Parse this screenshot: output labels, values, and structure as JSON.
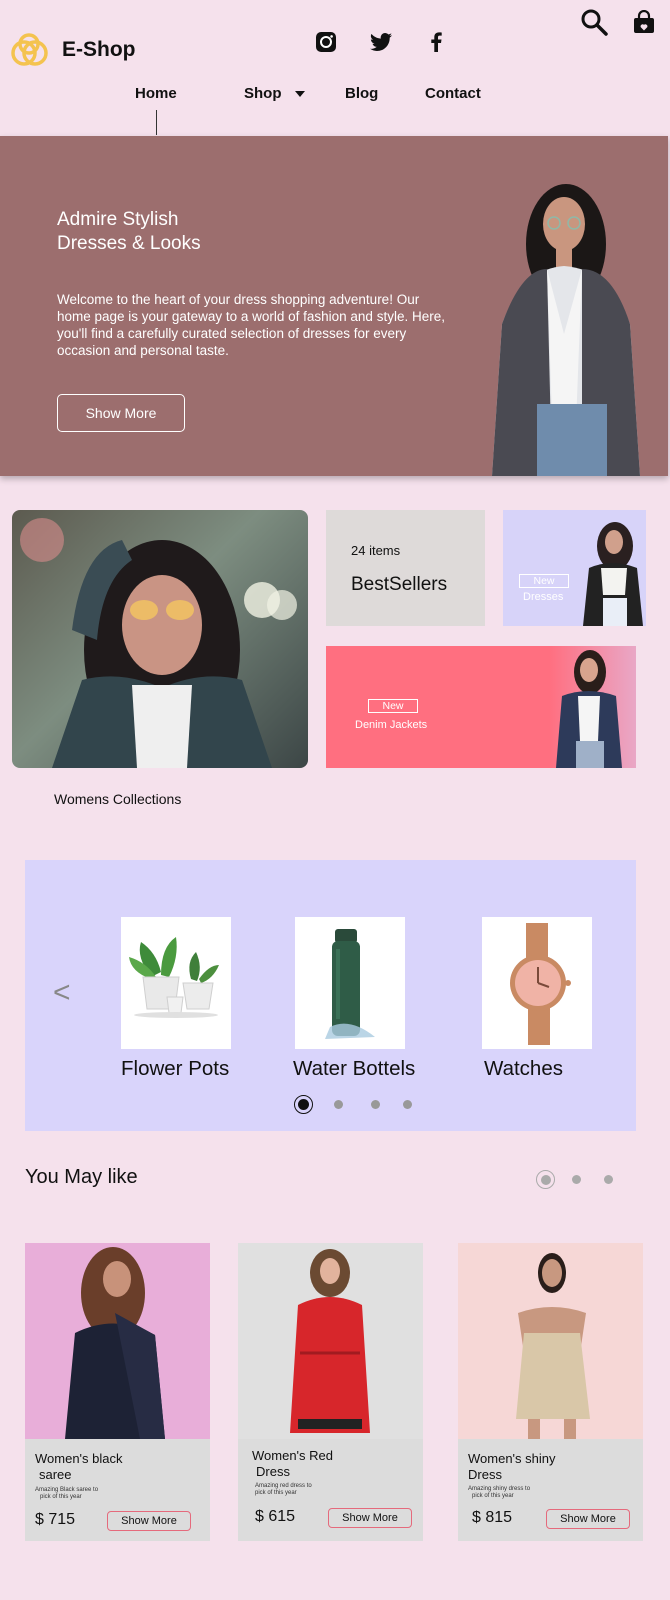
{
  "header": {
    "brand": "E-Shop",
    "logo_icon": "interlocking-rings-logo",
    "social": [
      "instagram-icon",
      "twitter-icon",
      "facebook-icon"
    ],
    "utility": [
      "search-icon",
      "shopping-bag-icon"
    ]
  },
  "nav": {
    "items": [
      {
        "label": "Home",
        "active": true
      },
      {
        "label": "Shop",
        "has_dropdown": true
      },
      {
        "label": "Blog"
      },
      {
        "label": "Contact"
      }
    ]
  },
  "hero": {
    "title_line1": "Admire Stylish",
    "title_line2": "Dresses & Looks",
    "text": "Welcome to the heart of your dress shopping adventure! Our home page is your gateway to a world of fashion and style. Here, you'll find a carefully curated selection of dresses for every occasion and personal taste.",
    "button": "Show More"
  },
  "collections": {
    "bestsellers": {
      "count": "24 items",
      "title": "BestSellers"
    },
    "dresses": {
      "badge": "New",
      "label": "Dresses"
    },
    "denim": {
      "badge": "New",
      "label": "Denim Jackets"
    },
    "label": "Womens Collections"
  },
  "carousel": {
    "prev_icon": "chevron-left-icon",
    "items": [
      {
        "name": "Flower Pots"
      },
      {
        "name": "Water Bottels"
      },
      {
        "name": "Watches"
      }
    ],
    "active_dot": 0,
    "dot_count": 4
  },
  "you_may_like": {
    "title": "You May like",
    "dot_count": 3,
    "products": [
      {
        "name_line1": "Women's black",
        "name_line2": "saree",
        "desc_line1": "Amazing Black saree to",
        "desc_line2": "pick of this year",
        "price": "$ 715",
        "button": "Show More"
      },
      {
        "name_line1": "Women's Red",
        "name_line2": "Dress",
        "desc_line1": "Amazing red dress to",
        "desc_line2": "pick of this year",
        "price": "$ 615",
        "button": "Show More"
      },
      {
        "name_line1": "Women's shiny",
        "name_line2": "Dress",
        "desc_line1": "Amazing shiny dress to",
        "desc_line2": "pick of this year",
        "price": "$ 815",
        "button": "Show More"
      }
    ]
  },
  "colors": {
    "page_bg": "#f5e1ec",
    "hero_bg": "#9c6e6e",
    "carousel_bg": "#d9d4fb",
    "denim_card": "#ff6f80",
    "accent_border": "#e56a7c"
  }
}
